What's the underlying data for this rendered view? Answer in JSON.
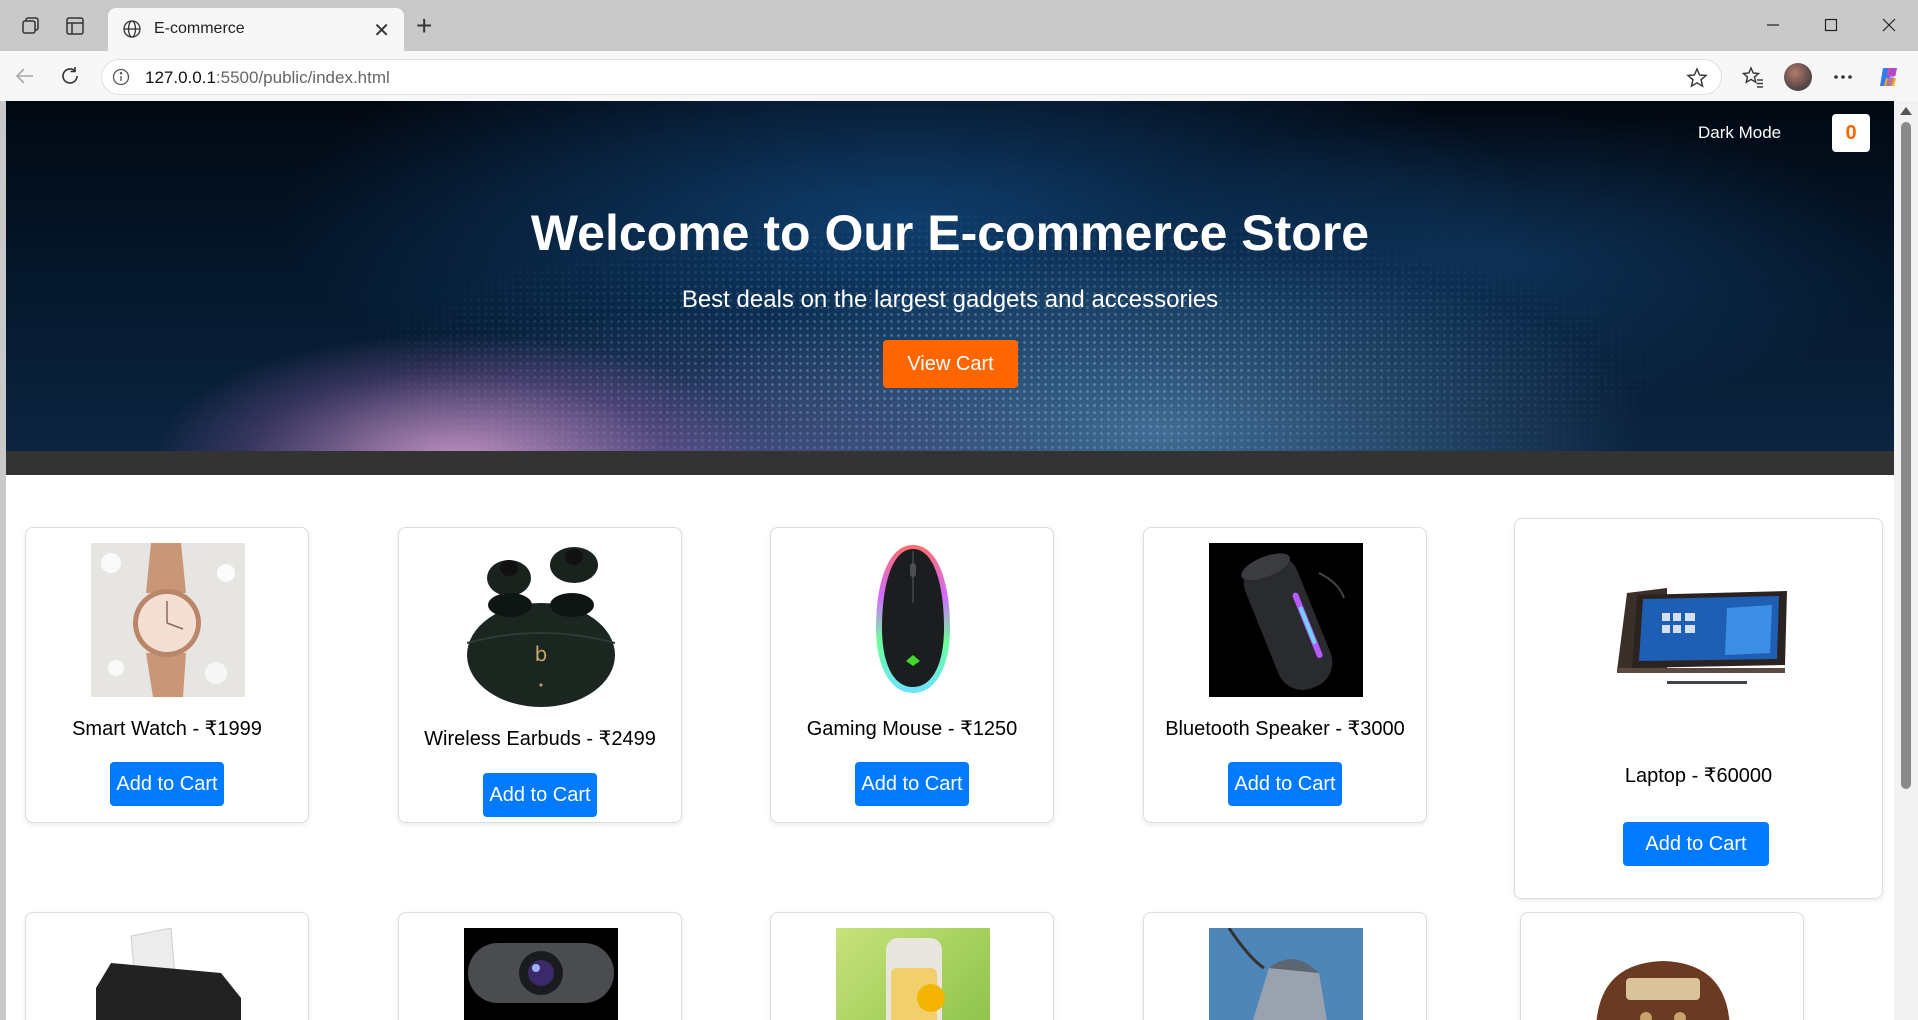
{
  "browser": {
    "tab_title": "E-commerce",
    "url_host": "127.0.0.1",
    "url_rest": ":5500/public/index.html"
  },
  "header": {
    "dark_mode_label": "Dark Mode",
    "cart_count": "0",
    "title": "Welcome to Our E-commerce Store",
    "subtitle": "Best deals on the largest gadgets and accessories",
    "view_cart_label": "View Cart"
  },
  "products": [
    {
      "name": "Smart Watch - ₹1999",
      "button": "Add to Cart",
      "image": "smart-watch"
    },
    {
      "name": "Wireless Earbuds - ₹2499",
      "button": "Add to Cart",
      "image": "wireless-earbuds"
    },
    {
      "name": "Gaming Mouse - ₹1250",
      "button": "Add to Cart",
      "image": "gaming-mouse"
    },
    {
      "name": "Bluetooth Speaker - ₹3000",
      "button": "Add to Cart",
      "image": "bluetooth-speaker"
    },
    {
      "name": "Laptop - ₹60000",
      "button": "Add to Cart",
      "image": "laptop"
    }
  ],
  "products_row2_images": [
    "printer",
    "webcam",
    "juicer",
    "steam-iron",
    "retro-radio"
  ],
  "colors": {
    "accent_orange": "#ff6600",
    "button_blue": "#007bff",
    "divider": "#333333"
  }
}
